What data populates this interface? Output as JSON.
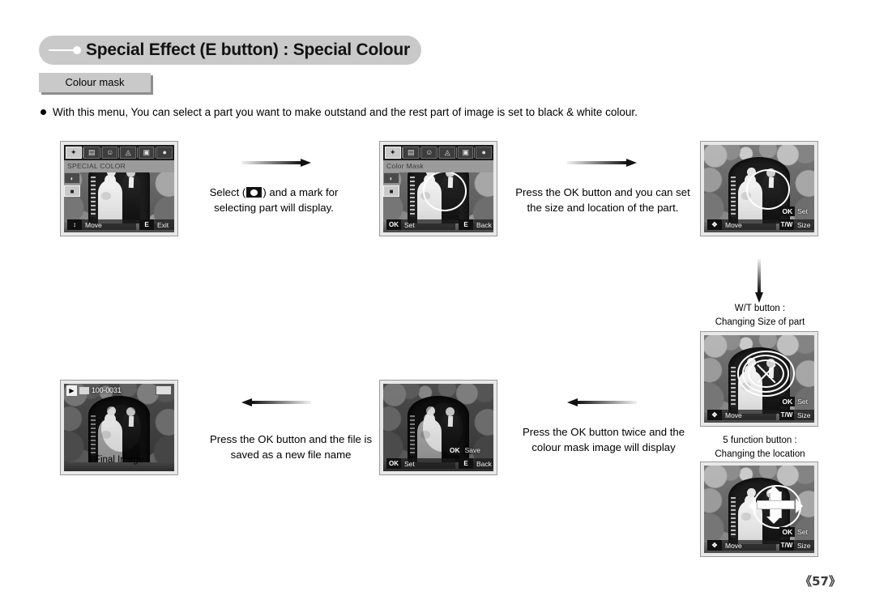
{
  "header": {
    "title": "Special Effect (E button) : Special Colour",
    "bullet_icon": "line-dot-icon"
  },
  "sub_tab": {
    "label": "Colour mask"
  },
  "intro": {
    "bullet": "●",
    "text": "With this menu, You can select a part you want to make outstand and the rest part of image is set to black & white colour."
  },
  "screens": {
    "menu_special_color": {
      "name": "SPECIAL COLOR",
      "menu_icons": [
        "star-icon",
        "scene-icon",
        "face-icon",
        "image-adjust-icon",
        "effect-icon",
        "palette-icon"
      ],
      "active_menu_index": 0,
      "title": "SPECIAL COLOR",
      "side_items": [
        "palette-icon",
        "colour-mask-icon"
      ],
      "side_selected_index": 1,
      "bar": [
        {
          "key": "↕",
          "label": "Move"
        },
        {
          "key": "E",
          "label": "Exit"
        }
      ]
    },
    "menu_color_mask": {
      "title": "Color Mask",
      "menu_icons": [
        "star-icon",
        "scene-icon",
        "face-icon",
        "image-adjust-icon",
        "effect-icon",
        "palette-icon"
      ],
      "active_menu_index": 0,
      "side_items": [
        "palette-icon",
        "colour-mask-icon"
      ],
      "side_selected_index": 1,
      "bar": [
        {
          "key": "OK",
          "label": "Set"
        },
        {
          "key": "E",
          "label": "Back"
        }
      ]
    },
    "size_location": {
      "float": {
        "key": "OK",
        "label": "Set"
      },
      "bar": [
        {
          "key": "✥",
          "label": "Move"
        },
        {
          "key": "T/W",
          "label": "Size"
        }
      ]
    },
    "changing_size": {
      "float": {
        "key": "OK",
        "label": "Set"
      },
      "bar": [
        {
          "key": "✥",
          "label": "Move"
        },
        {
          "key": "T/W",
          "label": "Size"
        }
      ]
    },
    "changing_location": {
      "float": {
        "key": "OK",
        "label": "Set"
      },
      "bar": [
        {
          "key": "✥",
          "label": "Move"
        },
        {
          "key": "T/W",
          "label": "Size"
        }
      ]
    },
    "mask_preview": {
      "float": {
        "key": "OK",
        "label": "Save"
      },
      "bar": [
        {
          "key": "OK",
          "label": "Set"
        },
        {
          "key": "E",
          "label": "Back"
        }
      ]
    },
    "final_image": {
      "play_icon": "playback-icon",
      "card_icon": "memory-card-icon",
      "file_name": "100-0031",
      "battery_icon": "battery-icon",
      "caption": "Final Image"
    }
  },
  "captions": {
    "select_mark": {
      "line1_pre": "Select (",
      "icon": "colour-mask-icon",
      "line1_post": ") and a mark for",
      "line2": "selecting part will display."
    },
    "press_ok_size": {
      "line1": "Press the OK button and you can set",
      "line2": "the size and location of the part."
    },
    "press_ok_twice": {
      "line1": "Press the OK button twice and the",
      "line2": "colour mask image will display"
    },
    "press_ok_save": {
      "line1": "Press the OK button and the file is",
      "line2": "saved as a new file name"
    },
    "wt_button": {
      "line1": "W/T button :",
      "line2": "Changing Size of part"
    },
    "five_function": {
      "line1": "5 function button :",
      "line2": "Changing the location"
    }
  },
  "footer": {
    "page_number": "《57》"
  }
}
